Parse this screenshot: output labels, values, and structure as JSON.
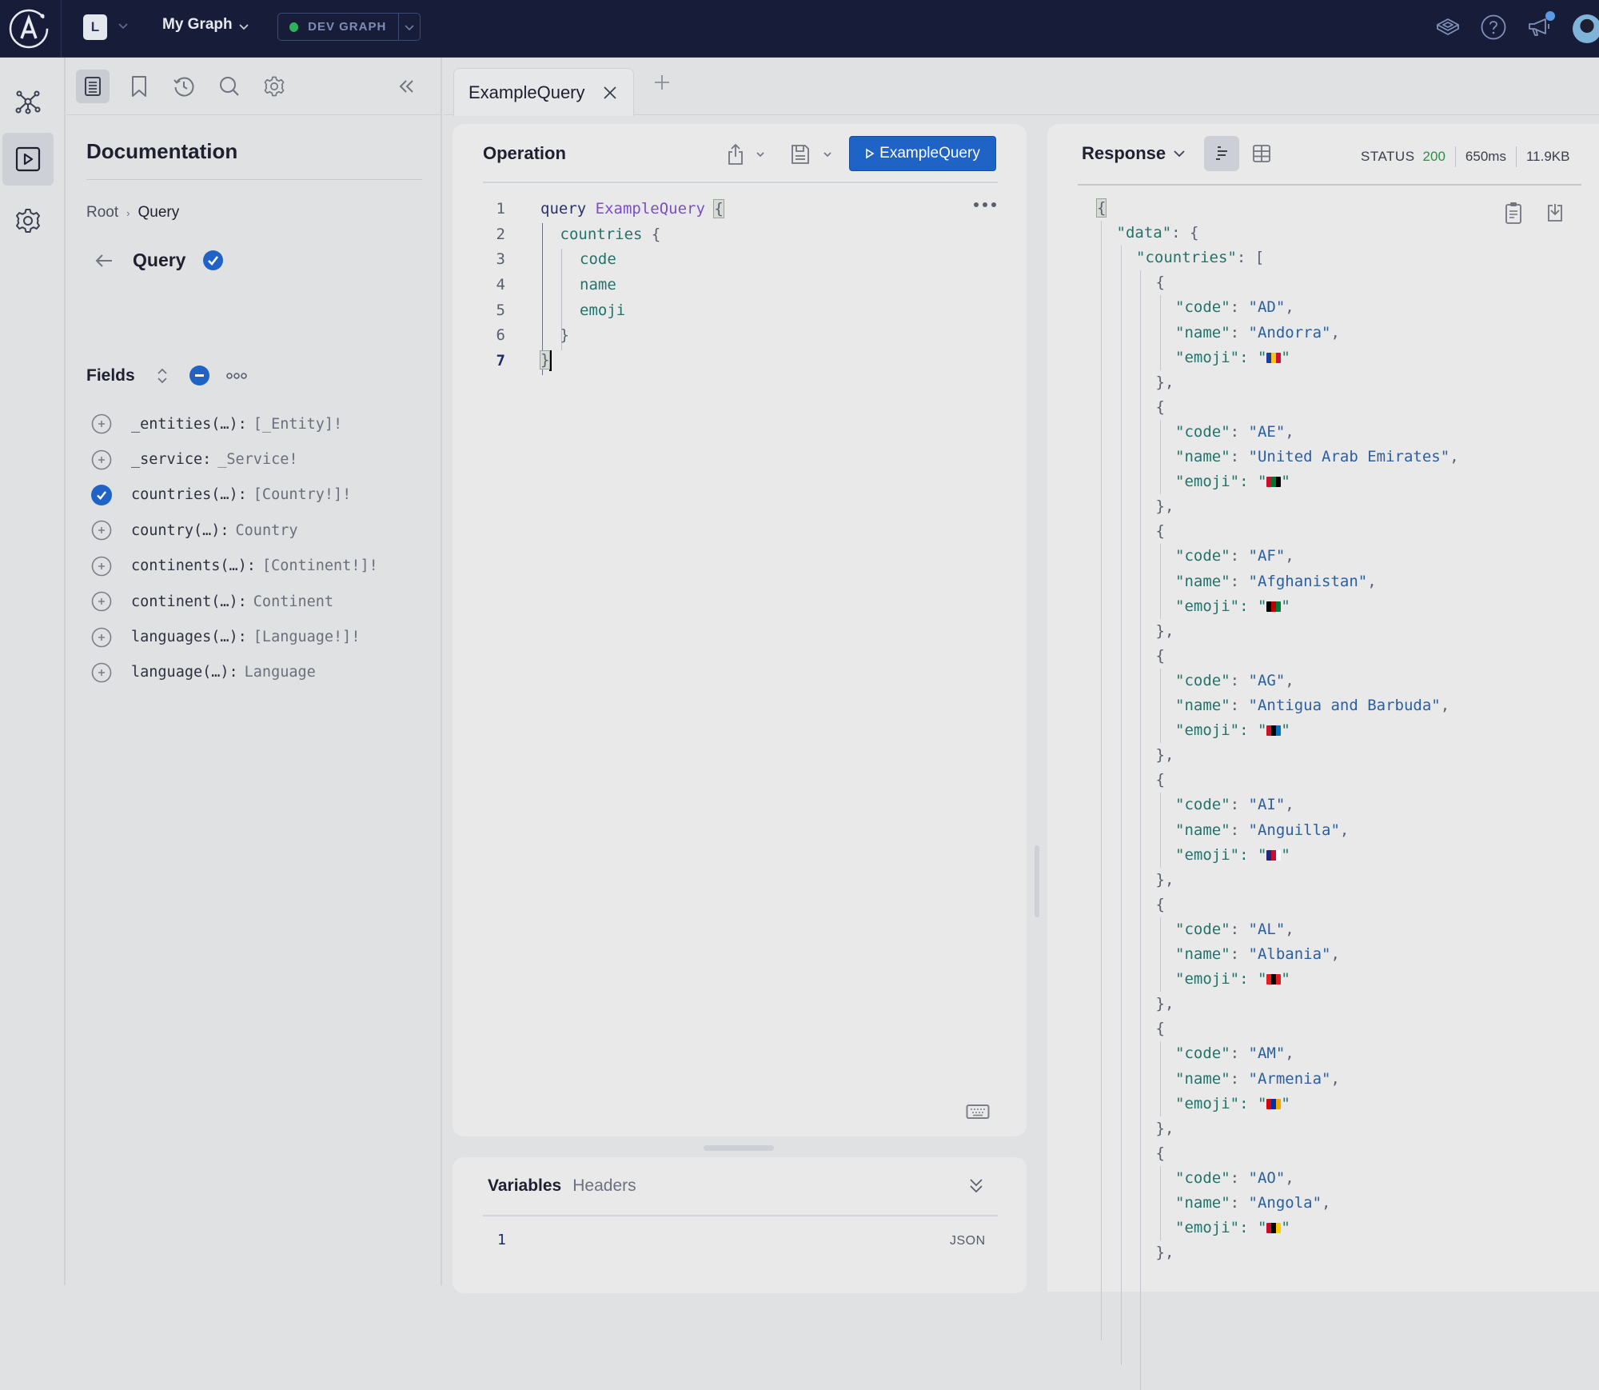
{
  "topbar": {
    "org_initial": "L",
    "graph_name": "My Graph",
    "variant": {
      "label": "DEV GRAPH",
      "status_color": "#2fb05a"
    },
    "icons": [
      "learn-icon",
      "help-icon",
      "announcements-icon",
      "user-avatar"
    ]
  },
  "rail": {
    "items": [
      {
        "name": "schema",
        "icon": "graph-icon"
      },
      {
        "name": "explorer",
        "icon": "play-square-icon",
        "active": true
      },
      {
        "name": "settings",
        "icon": "gear-icon"
      }
    ]
  },
  "docs": {
    "toolbar": [
      "documentation-icon",
      "bookmark-icon",
      "history-icon",
      "search-icon",
      "settings-icon",
      "collapse-icon"
    ],
    "title": "Documentation",
    "breadcrumb": {
      "root": "Root",
      "sep": "›",
      "current": "Query"
    },
    "type_name": "Query",
    "fields_label": "Fields",
    "fields": [
      {
        "name": "_entities(…):",
        "type": "[_Entity]!",
        "selected": false
      },
      {
        "name": "_service:",
        "type": "_Service!",
        "selected": false
      },
      {
        "name": "countries(…):",
        "type": "[Country!]!",
        "selected": true
      },
      {
        "name": "country(…):",
        "type": "Country",
        "selected": false
      },
      {
        "name": "continents(…):",
        "type": "[Continent!]!",
        "selected": false
      },
      {
        "name": "continent(…):",
        "type": "Continent",
        "selected": false
      },
      {
        "name": "languages(…):",
        "type": "[Language!]!",
        "selected": false
      },
      {
        "name": "language(…):",
        "type": "Language",
        "selected": false
      }
    ]
  },
  "tabs": [
    {
      "label": "ExampleQuery",
      "active": true
    }
  ],
  "operation": {
    "title": "Operation",
    "run_label": "ExampleQuery",
    "lines": [
      {
        "n": "1",
        "kw": "query ",
        "name": "ExampleQuery",
        "rest": " {"
      },
      {
        "n": "2",
        "field": "countries",
        "rest": " {"
      },
      {
        "n": "3",
        "field": "code"
      },
      {
        "n": "4",
        "field": "name"
      },
      {
        "n": "5",
        "field": "emoji"
      },
      {
        "n": "6",
        "rest": "}"
      },
      {
        "n": "7",
        "rest": "}"
      }
    ]
  },
  "variables": {
    "tabs": [
      "Variables",
      "Headers"
    ],
    "line_number": "1",
    "mode": "JSON"
  },
  "response": {
    "title": "Response",
    "status_label": "STATUS",
    "status_code": "200",
    "time": "650ms",
    "size": "11.9KB",
    "countries": [
      {
        "code": "AD",
        "name": "Andorra",
        "flag": [
          "#1b3f9a",
          "#f4c51b",
          "#d21034"
        ]
      },
      {
        "code": "AE",
        "name": "United Arab Emirates",
        "flag": [
          "#c8102e",
          "#00732f",
          "#000000"
        ]
      },
      {
        "code": "AF",
        "name": "Afghanistan",
        "flag": [
          "#000000",
          "#be0000",
          "#007a36"
        ]
      },
      {
        "code": "AG",
        "name": "Antigua and Barbuda",
        "flag": [
          "#ce1126",
          "#000000",
          "#0072c6"
        ]
      },
      {
        "code": "AI",
        "name": "Anguilla",
        "flag": [
          "#1b2a7a",
          "#c8102e",
          "#ffffff"
        ]
      },
      {
        "code": "AL",
        "name": "Albania",
        "flag": [
          "#e41e20",
          "#000000",
          "#e41e20"
        ]
      },
      {
        "code": "AM",
        "name": "Armenia",
        "flag": [
          "#d90012",
          "#0033a0",
          "#f2a800"
        ]
      },
      {
        "code": "AO",
        "name": "Angola",
        "flag": [
          "#cc092f",
          "#000000",
          "#ffcb00"
        ]
      }
    ]
  }
}
